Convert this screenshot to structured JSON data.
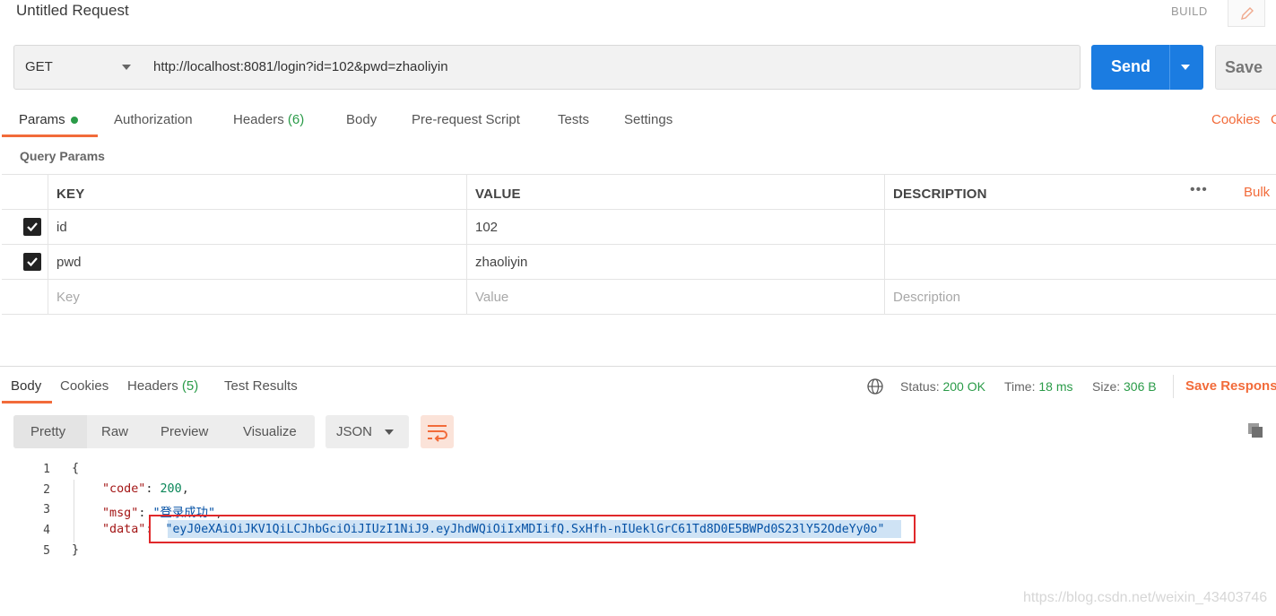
{
  "header": {
    "title": "Untitled Request",
    "build_label": "BUILD",
    "edit_icon": "pencil-icon"
  },
  "request": {
    "method": "GET",
    "url": "http://localhost:8081/login?id=102&pwd=zhaoliyin",
    "send_label": "Send",
    "save_label": "Save"
  },
  "tabs": {
    "params": "Params",
    "authorization": "Authorization",
    "headers": "Headers",
    "headers_count": "(6)",
    "body": "Body",
    "prerequest": "Pre-request Script",
    "tests": "Tests",
    "settings": "Settings",
    "cookies_link": "Cookies",
    "code_link": "C"
  },
  "params": {
    "section_title": "Query Params",
    "columns": {
      "key": "KEY",
      "value": "VALUE",
      "description": "DESCRIPTION"
    },
    "bulk_label": "Bulk",
    "more_label": "•••",
    "rows": [
      {
        "checked": true,
        "key": "id",
        "value": "102",
        "description": ""
      },
      {
        "checked": true,
        "key": "pwd",
        "value": "zhaoliyin",
        "description": ""
      }
    ],
    "placeholders": {
      "key": "Key",
      "value": "Value",
      "description": "Description"
    }
  },
  "response": {
    "tabs": {
      "body": "Body",
      "cookies": "Cookies",
      "headers": "Headers",
      "headers_count": "(5)",
      "test_results": "Test Results"
    },
    "status_label": "Status:",
    "status_value": "200 OK",
    "time_label": "Time:",
    "time_value": "18 ms",
    "size_label": "Size:",
    "size_value": "306 B",
    "save_response": "Save Response",
    "formats": {
      "pretty": "Pretty",
      "raw": "Raw",
      "preview": "Preview",
      "visualize": "Visualize"
    },
    "language": "JSON",
    "code": {
      "line_numbers": [
        "1",
        "2",
        "3",
        "4",
        "5"
      ],
      "open": "{",
      "close": "}",
      "code_key": "\"code\"",
      "code_value": "200",
      "msg_key": "\"msg\"",
      "msg_value": "\"登录成功\"",
      "data_key": "\"data\"",
      "data_value": "\"eyJ0eXAiOiJKV1QiLCJhbGciOiJIUzI1NiJ9.eyJhdWQiOiIxMDIifQ.SxHfh-nIUeklGrC61Td8D0E5BWPd0S23lY52OdeYy0o\""
    }
  },
  "watermark": "https://blog.csdn.net/weixin_43403746",
  "colors": {
    "accent": "#f26b3a",
    "send": "#1b7ce1",
    "green": "#2a9b48",
    "highlight": "#e0282a"
  }
}
